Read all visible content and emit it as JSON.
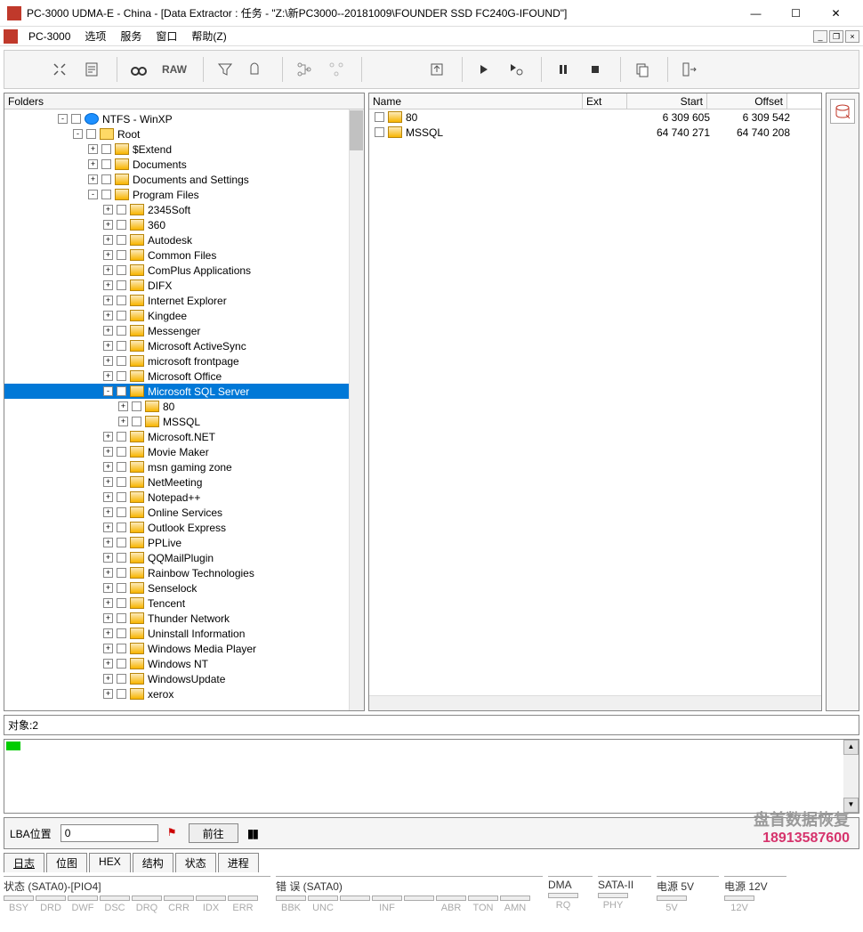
{
  "title": "PC-3000 UDMA-E - China - [Data Extractor : 任务 - \"Z:\\新PC3000--20181009\\FOUNDER SSD FC240G-IFOUND\"]",
  "menu": {
    "app": "PC-3000",
    "options": "选项",
    "services": "服务",
    "window": "窗口",
    "help": "帮助(Z)"
  },
  "toolbar": {
    "raw": "RAW"
  },
  "folders_label": "Folders",
  "tree": {
    "root_fs": "NTFS - WinXP",
    "root": "Root",
    "items": [
      "$Extend",
      "Documents",
      "Documents and Settings",
      "Program Files"
    ],
    "pf": [
      "2345Soft",
      "360",
      "Autodesk",
      "Common Files",
      "ComPlus Applications",
      "DIFX",
      "Internet Explorer",
      "Kingdee",
      "Messenger",
      "Microsoft ActiveSync",
      "microsoft frontpage",
      "Microsoft Office",
      "Microsoft SQL Server"
    ],
    "sql_children": [
      "80",
      "MSSQL"
    ],
    "pf_after": [
      "Microsoft.NET",
      "Movie Maker",
      "msn gaming zone",
      "NetMeeting",
      "Notepad++",
      "Online Services",
      "Outlook Express",
      "PPLive",
      "QQMailPlugin",
      "Rainbow Technologies",
      "Senselock",
      "Tencent",
      "Thunder Network",
      "Uninstall Information",
      "Windows Media Player",
      "Windows NT",
      "WindowsUpdate",
      "xerox"
    ]
  },
  "list": {
    "cols": {
      "name": "Name",
      "ext": "Ext",
      "start": "Start",
      "offset": "Offset"
    },
    "rows": [
      {
        "name": "80",
        "ext": "",
        "start": "6 309 605",
        "offset": "6 309 542"
      },
      {
        "name": "MSSQL",
        "ext": "",
        "start": "64 740 271",
        "offset": "64 740 208"
      }
    ]
  },
  "status": {
    "objects": "对象:2"
  },
  "lba": {
    "label": "LBA位置",
    "value": "0",
    "go": "前往"
  },
  "watermark": {
    "line1": "盘首数据恢复",
    "line2": "18913587600"
  },
  "tabs": {
    "log": "日志",
    "bitmap": "位图",
    "hex": "HEX",
    "struct": "结构",
    "state": "状态",
    "process": "进程"
  },
  "bottom": {
    "state_title": "状态 (SATA0)-[PIO4]",
    "state": [
      "BSY",
      "DRD",
      "DWF",
      "DSC",
      "DRQ",
      "CRR",
      "IDX",
      "ERR"
    ],
    "err_title": "错 误 (SATA0)",
    "err": [
      "BBK",
      "UNC",
      "",
      "INF",
      "",
      "ABR",
      "TON",
      "AMN"
    ],
    "dma_title": "DMA",
    "dma": [
      "RQ"
    ],
    "sata_title": "SATA-II",
    "sata": [
      "PHY"
    ],
    "p5_title": "电源 5V",
    "p5": [
      "5V"
    ],
    "p12_title": "电源 12V",
    "p12": [
      "12V"
    ]
  }
}
